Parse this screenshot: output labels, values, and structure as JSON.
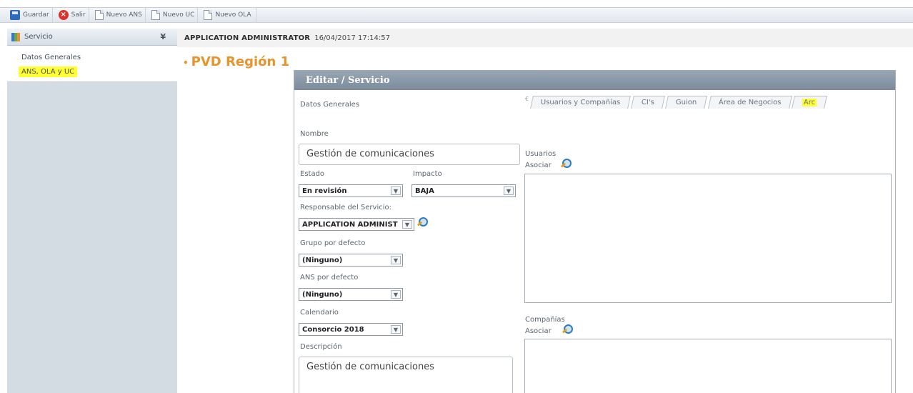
{
  "toolbar": {
    "save": "Guardar",
    "exit": "Salir",
    "new_ans": "Nuevo ANS",
    "new_uc": "Nuevo UC",
    "new_ola": "Nuevo OLA"
  },
  "sidebar": {
    "title": "Servicio",
    "collapse": "¥",
    "items": [
      {
        "label": "Datos Generales"
      },
      {
        "label": "ANS, OLA y UC"
      }
    ]
  },
  "user_bar": {
    "user": "APPLICATION ADMINISTRATOR",
    "datetime": "16/04/2017 17:14:57"
  },
  "page": {
    "bullet": "•",
    "title": "PVD Región 1"
  },
  "panel": {
    "header": "Editar / Servicio",
    "section": "Datos Generales",
    "nombre_label": "Nombre",
    "nombre_value": "Gestión de comunicaciones",
    "estado_label": "Estado",
    "estado_value": "En revisión",
    "impacto_label": "Impacto",
    "impacto_value": "BAJA",
    "responsable_label": "Responsable del Servicio:",
    "responsable_value": "APPLICATION ADMINIST",
    "grupo_label": "Grupo por defecto",
    "grupo_value": "(Ninguno)",
    "ans_label": "ANS por defecto",
    "ans_value": "(Ninguno)",
    "calendario_label": "Calendario",
    "calendario_value": "Consorcio 2018",
    "descripcion_label": "Descripción",
    "descripcion_value": "Gestión de comunicaciones"
  },
  "tabs": {
    "mark": "€",
    "items": [
      {
        "label": "Usuarios y Compañías"
      },
      {
        "label": "CI's"
      },
      {
        "label": "Guion"
      },
      {
        "label": "Área de Negocios"
      },
      {
        "label": "Arc"
      }
    ]
  },
  "right": {
    "usuarios_label": "Usuarios",
    "usuarios_assoc": "Asociar",
    "companias_label": "Compañías",
    "companias_assoc": "Asociar"
  }
}
